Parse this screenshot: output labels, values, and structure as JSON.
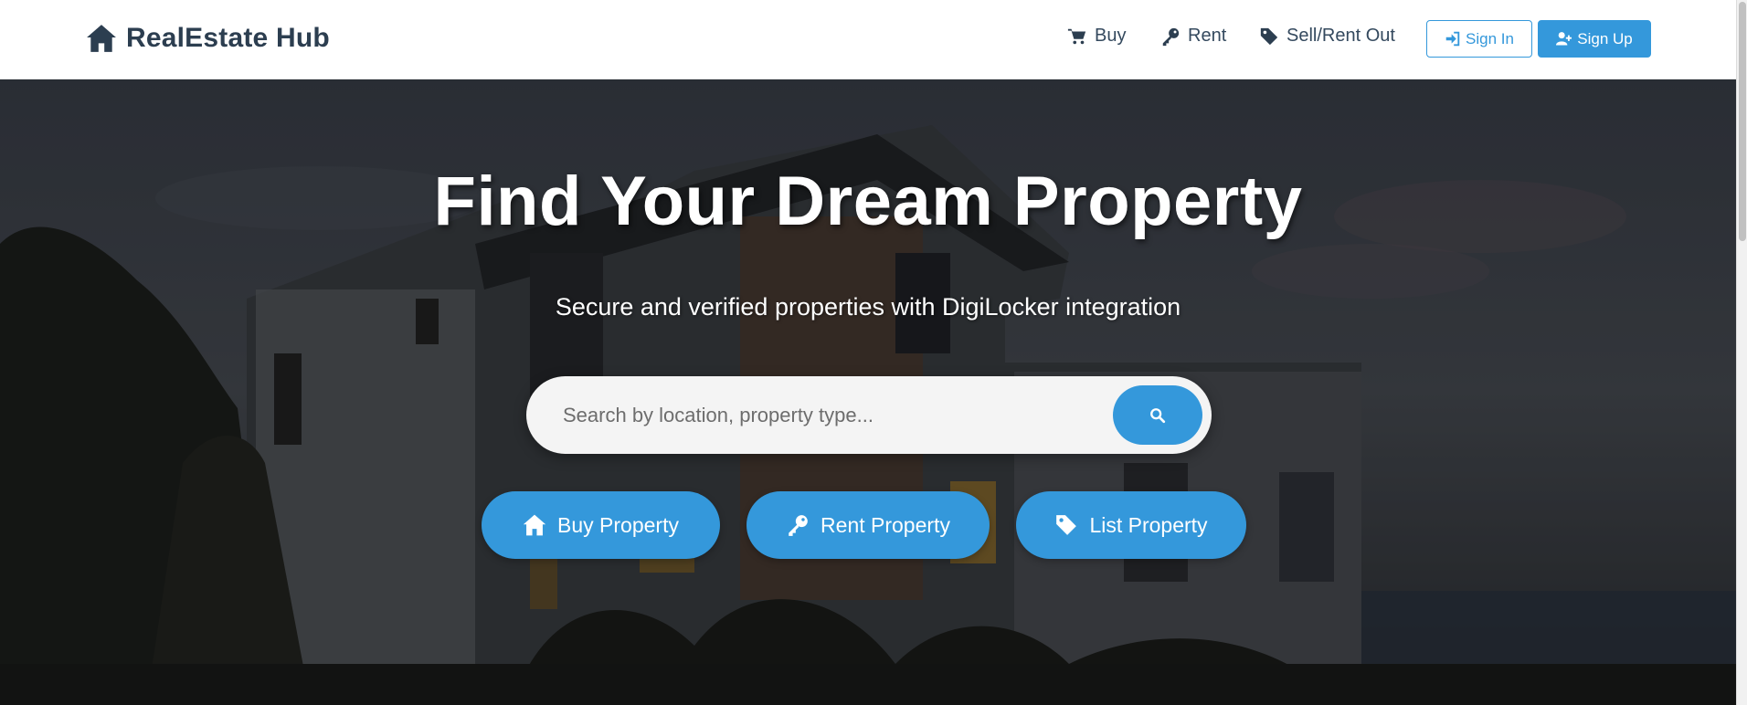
{
  "brand": {
    "name": "RealEstate Hub",
    "icon": "home-icon"
  },
  "nav": {
    "items": [
      {
        "label": "Buy",
        "icon": "cart-icon"
      },
      {
        "label": "Rent",
        "icon": "key-icon"
      },
      {
        "label": "Sell/Rent Out",
        "icon": "tag-icon"
      }
    ],
    "sign_in": "Sign In",
    "sign_up": "Sign Up"
  },
  "hero": {
    "title": "Find Your Dream Property",
    "subtitle": "Secure and verified properties with DigiLocker integration",
    "search": {
      "placeholder": "Search by location, property type...",
      "value": ""
    },
    "buttons": [
      {
        "label": "Buy Property",
        "icon": "home-icon"
      },
      {
        "label": "Rent Property",
        "icon": "key-icon"
      },
      {
        "label": "List Property",
        "icon": "tag-icon"
      }
    ]
  },
  "colors": {
    "accent": "#3498db",
    "brand_text": "#2c3e50",
    "nav_text": "#34495e"
  }
}
